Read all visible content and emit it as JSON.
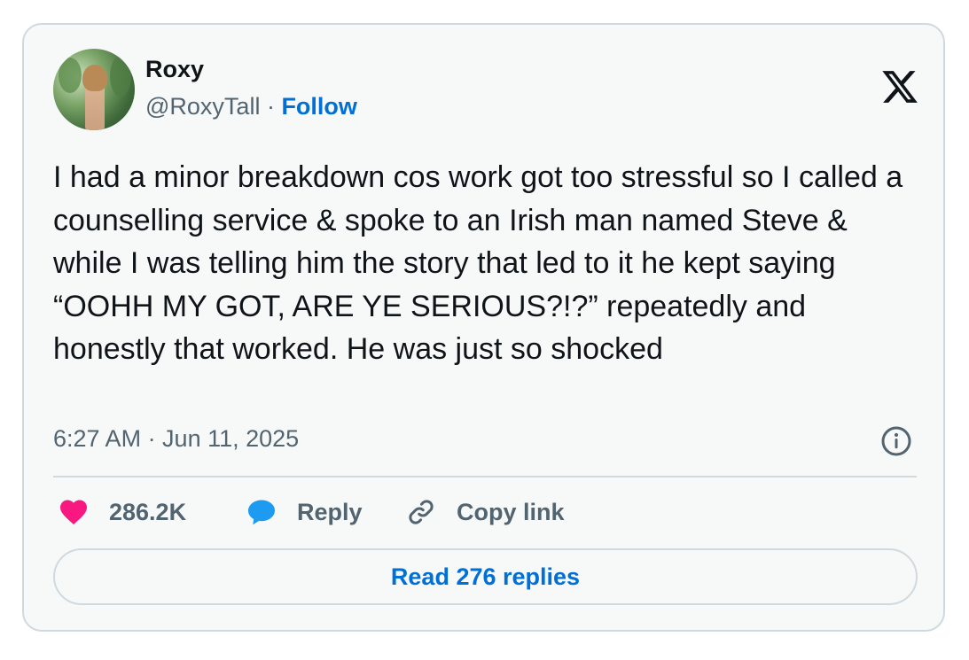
{
  "author": {
    "name": "Roxy",
    "handle": "@RoxyTall",
    "separator": " · ",
    "follow_label": "Follow"
  },
  "tweet": {
    "text": "I had a minor breakdown cos work got too stressful so I called a counselling service & spoke to an Irish man named Steve & while I was telling him the story that led to it he kept saying “OOHH MY GOT, ARE YE SERIOUS?!?” repeatedly and honestly that worked. He was just so shocked",
    "timestamp": "6:27 AM · Jun 11, 2025"
  },
  "actions": {
    "like_count": "286.2K",
    "reply_label": "Reply",
    "copy_link_label": "Copy link"
  },
  "read_replies_label": "Read 276 replies",
  "icons": {
    "brand": "x-logo-icon",
    "info": "info-icon",
    "like": "heart-icon",
    "reply": "speech-bubble-icon",
    "copy": "link-icon"
  },
  "colors": {
    "accent": "#006fd6",
    "heart": "#f91880",
    "reply_bubble": "#1d9bf0",
    "muted_text": "#536471",
    "border": "#cfd9de",
    "card_bg": "#f7f9f9"
  }
}
